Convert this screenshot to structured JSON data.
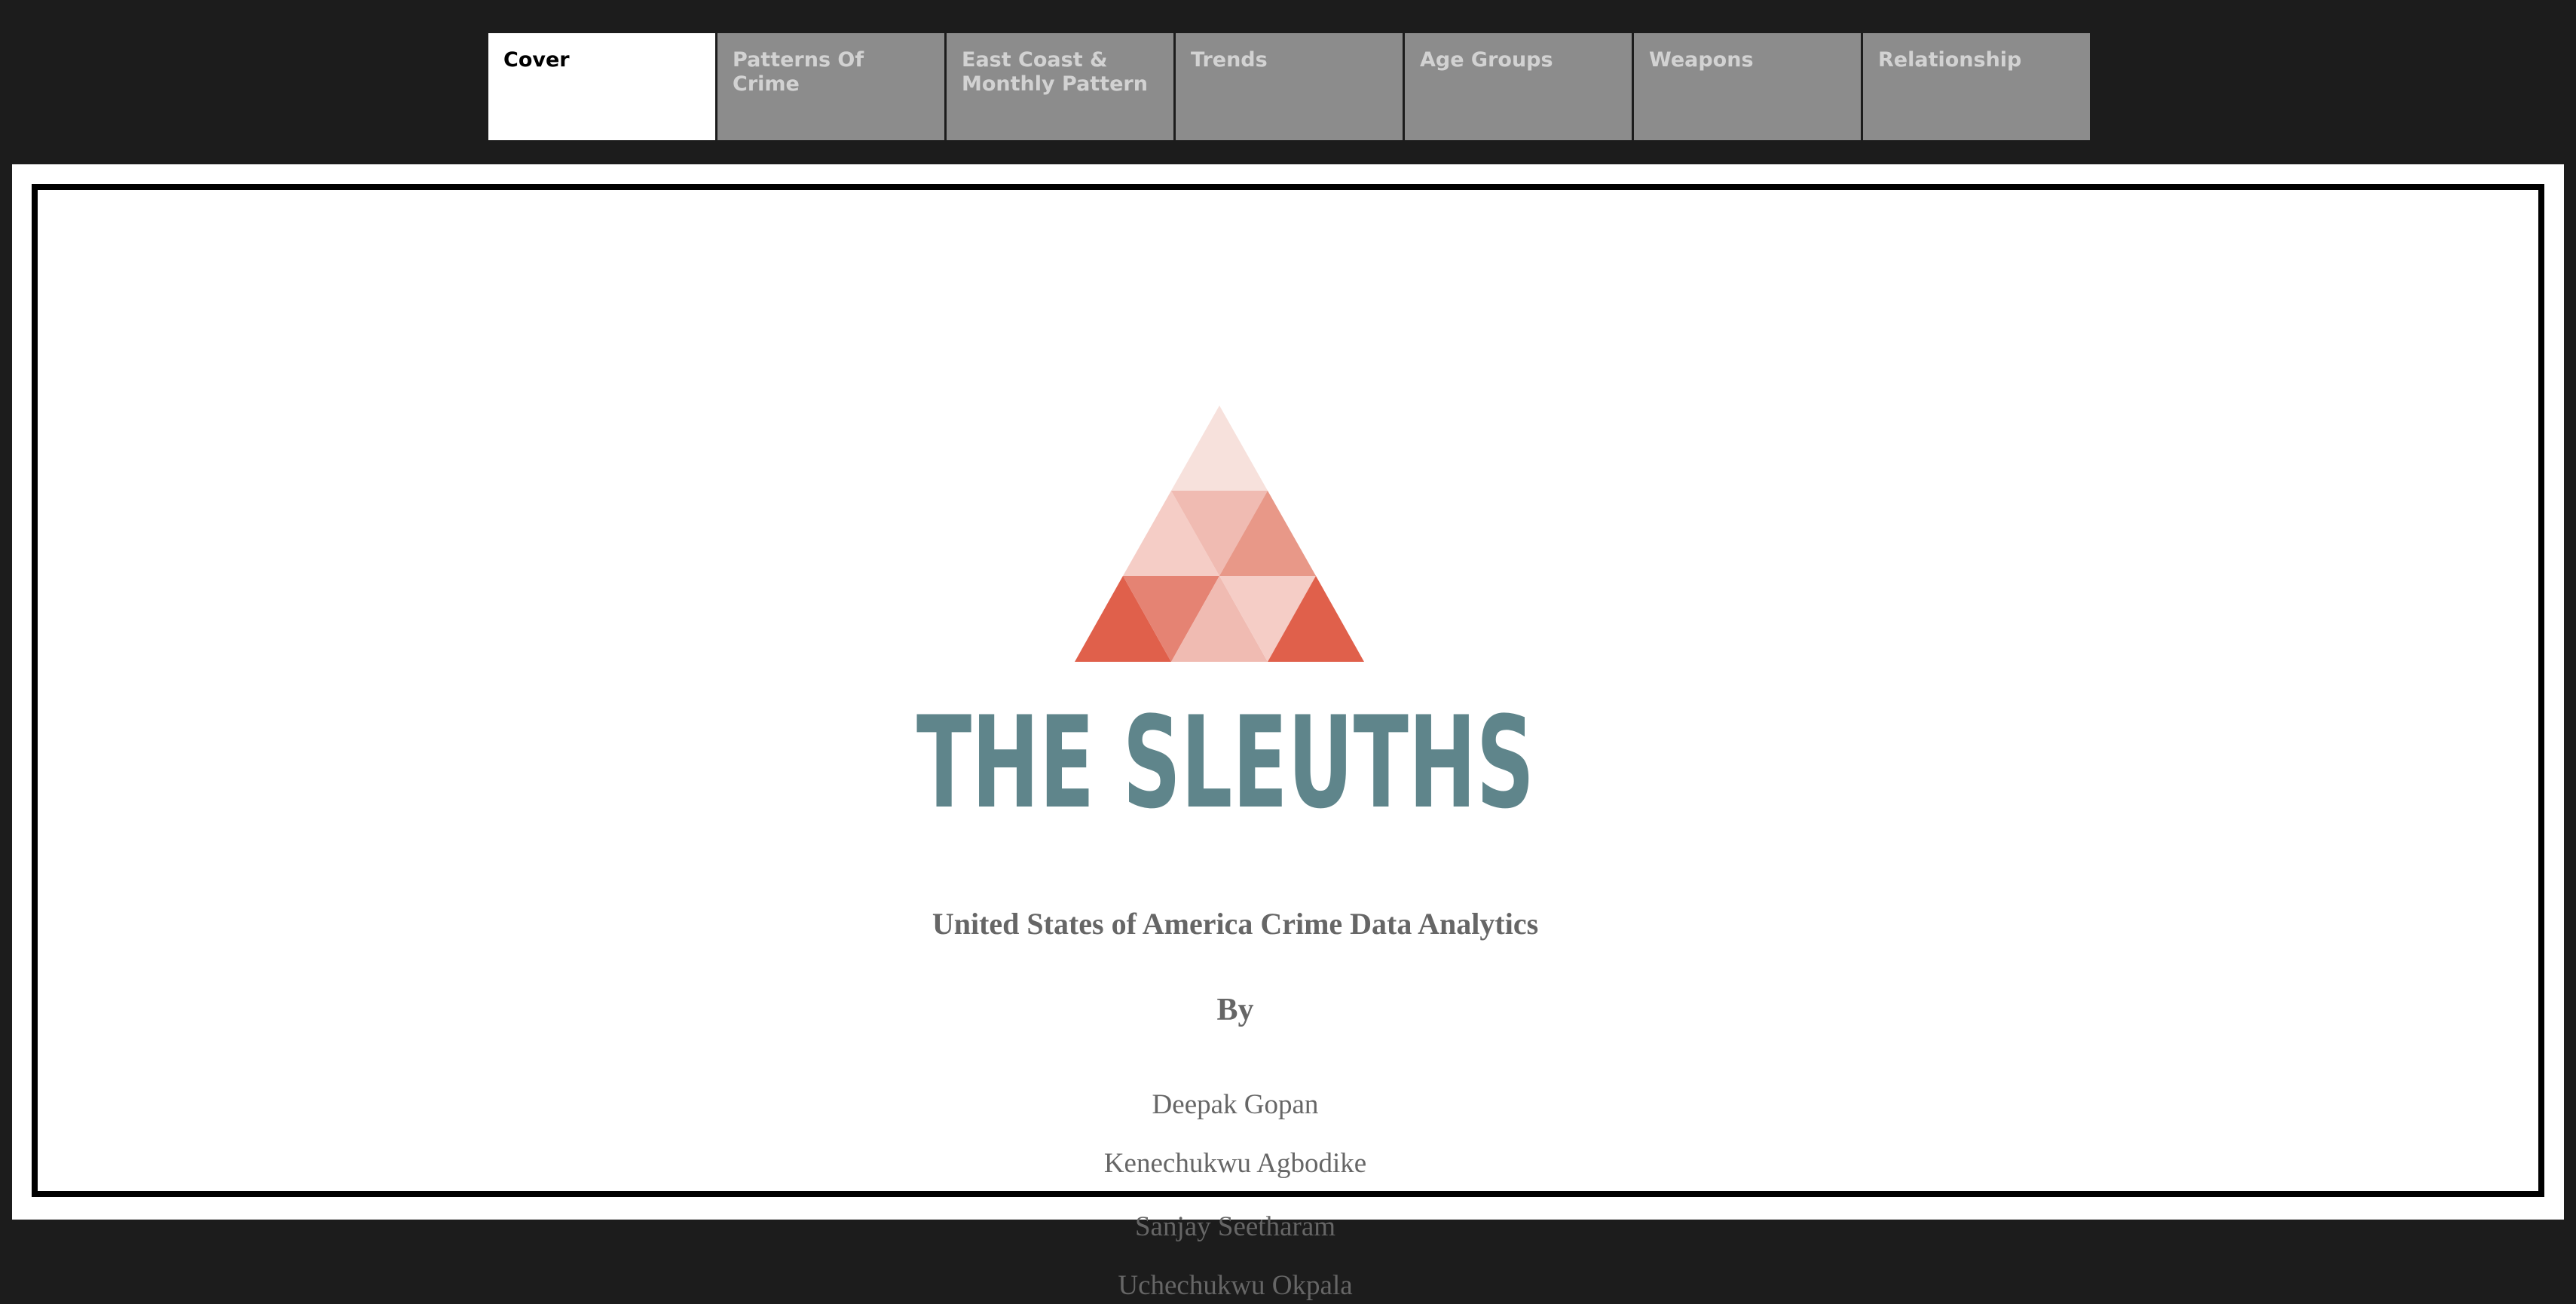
{
  "tabs": [
    {
      "label": "Cover",
      "active": true
    },
    {
      "label": "Patterns Of Crime",
      "active": false
    },
    {
      "label": "East Coast & Monthly Pattern",
      "active": false
    },
    {
      "label": "Trends",
      "active": false
    },
    {
      "label": "Age Groups",
      "active": false
    },
    {
      "label": "Weapons",
      "active": false
    },
    {
      "label": "Relationship",
      "active": false
    }
  ],
  "logo": {
    "text": "THE SLEUTHS",
    "text_color": "#5f858b",
    "triangle_colors": [
      "#f7e1dc",
      "#f0bbb2",
      "#e89888",
      "#f5cdc6",
      "#e0604b",
      "#e58373"
    ]
  },
  "cover": {
    "title": "United States of America Crime Data Analytics",
    "by": "By",
    "authors": [
      "Deepak Gopan",
      "Kenechukwu Agbodike",
      "Sanjay Seetharam",
      "Uchechukwu Okpala"
    ]
  },
  "colors": {
    "background": "#1c1c1c",
    "tab_inactive": "#8c8c8c",
    "tab_inactive_text": "#d2d2d2",
    "tab_active": "#ffffff",
    "tab_active_text": "#000000",
    "cover_text": "#666666"
  }
}
